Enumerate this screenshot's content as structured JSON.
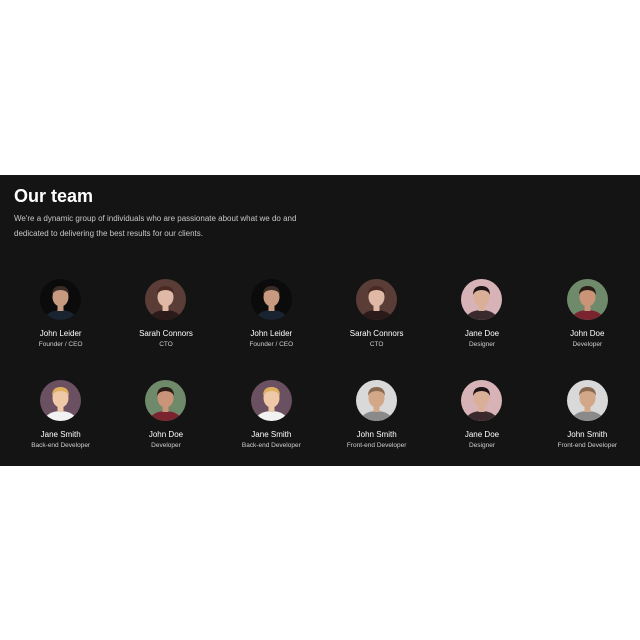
{
  "section": {
    "title": "Our team",
    "intro_line1": "We're a dynamic group of individuals who are passionate about what we do and",
    "intro_line2": "dedicated to delivering the best results for our clients."
  },
  "members": [
    {
      "name": "John Leider",
      "role": "Founder / CEO",
      "avatar": "john-leider",
      "bg": "#0b0b0b",
      "skin": "#c89a80",
      "hair": "#3a2c26",
      "shirt": "#1a2330"
    },
    {
      "name": "Sarah Connors",
      "role": "CTO",
      "avatar": "sarah-connors",
      "bg": "#5a3d36",
      "skin": "#e0b9a6",
      "hair": "#4a2a22",
      "shirt": "#2b1b18"
    },
    {
      "name": "John Leider",
      "role": "Founder / CEO",
      "avatar": "john-leider",
      "bg": "#0b0b0b",
      "skin": "#c89a80",
      "hair": "#3a2c26",
      "shirt": "#1a2330"
    },
    {
      "name": "Sarah Connors",
      "role": "CTO",
      "avatar": "sarah-connors",
      "bg": "#5a3d36",
      "skin": "#e0b9a6",
      "hair": "#4a2a22",
      "shirt": "#2b1b18"
    },
    {
      "name": "Jane Doe",
      "role": "Designer",
      "avatar": "jane-doe",
      "bg": "#d7b3b8",
      "skin": "#d9b097",
      "hair": "#1e1414",
      "shirt": "#3a2a2e"
    },
    {
      "name": "John Doe",
      "role": "Developer",
      "avatar": "john-doe",
      "bg": "#6f8a6a",
      "skin": "#c99478",
      "hair": "#2a1c16",
      "shirt": "#7a2430"
    },
    {
      "name": "Jane Smith",
      "role": "Back-end Developer",
      "avatar": "jane-smith",
      "bg": "#6a5060",
      "skin": "#efc8a8",
      "hair": "#e0b060",
      "shirt": "#f2f2f2"
    },
    {
      "name": "John Doe",
      "role": "Developer",
      "avatar": "john-doe",
      "bg": "#6f8a6a",
      "skin": "#c99478",
      "hair": "#2a1c16",
      "shirt": "#7a2430"
    },
    {
      "name": "Jane Smith",
      "role": "Back-end Developer",
      "avatar": "jane-smith",
      "bg": "#6a5060",
      "skin": "#efc8a8",
      "hair": "#e0b060",
      "shirt": "#f2f2f2"
    },
    {
      "name": "John Smith",
      "role": "Front-end Developer",
      "avatar": "john-smith",
      "bg": "#d9d9d9",
      "skin": "#d2a888",
      "hair": "#8a6a50",
      "shirt": "#8a8a8a"
    },
    {
      "name": "Jane Doe",
      "role": "Designer",
      "avatar": "jane-doe",
      "bg": "#d7b3b8",
      "skin": "#d9b097",
      "hair": "#1e1414",
      "shirt": "#3a2a2e"
    },
    {
      "name": "John Smith",
      "role": "Front-end Developer",
      "avatar": "john-smith",
      "bg": "#d9d9d9",
      "skin": "#d2a888",
      "hair": "#8a6a50",
      "shirt": "#8a8a8a"
    }
  ]
}
